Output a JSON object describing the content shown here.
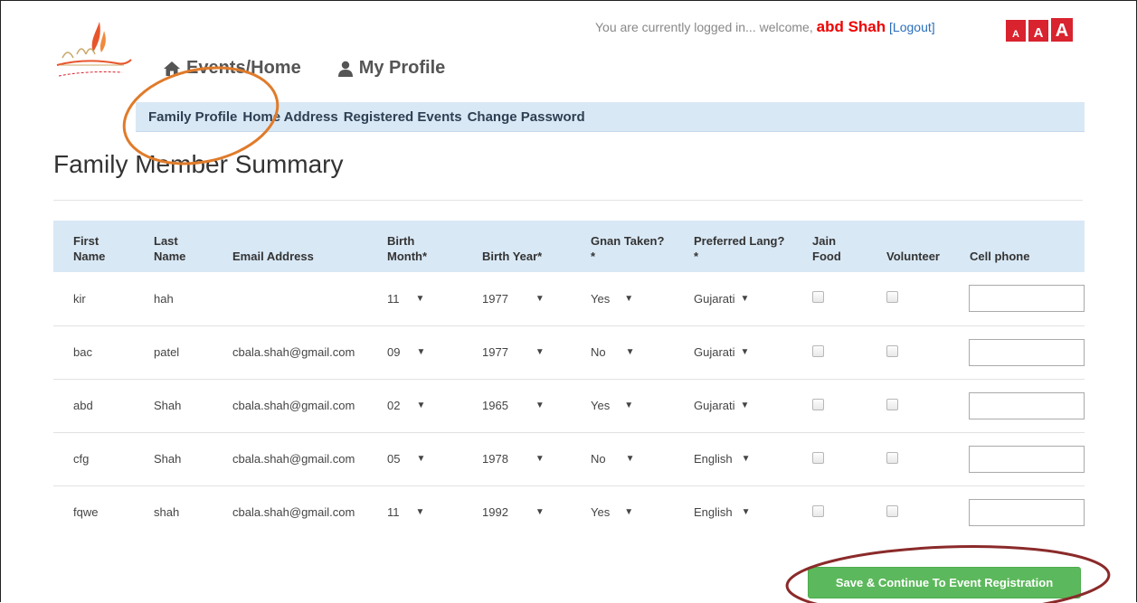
{
  "header": {
    "login_prefix": "You are currently logged in... welcome,",
    "user_name": "abd Shah",
    "logout_label": "[Logout]",
    "font_size_labels": [
      "A",
      "A",
      "A"
    ]
  },
  "top_nav": {
    "events_home": "Events/Home",
    "my_profile": "My Profile"
  },
  "sub_nav": [
    "Family Profile",
    "Home Address",
    "Registered Events",
    "Change Password"
  ],
  "page_title": "Family Member Summary",
  "table": {
    "headers": {
      "first_name": [
        "First",
        "Name"
      ],
      "last_name": [
        "Last",
        "Name"
      ],
      "email": "Email Address",
      "birth_month": [
        "Birth",
        "Month*"
      ],
      "birth_year": "Birth Year*",
      "gnan_taken": [
        "Gnan Taken?",
        "*"
      ],
      "preferred_lang": [
        "Preferred Lang?",
        "*"
      ],
      "jain_food": [
        "Jain",
        "Food"
      ],
      "volunteer": "Volunteer",
      "cell_phone": "Cell phone"
    },
    "rows": [
      {
        "first": "kir",
        "last": "hah",
        "email": "",
        "month": "11",
        "year": "1977",
        "gnan": "Yes",
        "lang": "Gujarati",
        "jain_food": false,
        "volunteer": false,
        "cell": ""
      },
      {
        "first": "bac",
        "last": "patel",
        "email": "cbala.shah@gmail.com",
        "month": "09",
        "year": "1977",
        "gnan": "No",
        "lang": "Gujarati",
        "jain_food": false,
        "volunteer": false,
        "cell": ""
      },
      {
        "first": "abd",
        "last": "Shah",
        "email": "cbala.shah@gmail.com",
        "month": "02",
        "year": "1965",
        "gnan": "Yes",
        "lang": "Gujarati",
        "jain_food": false,
        "volunteer": false,
        "cell": ""
      },
      {
        "first": "cfg",
        "last": "Shah",
        "email": "cbala.shah@gmail.com",
        "month": "05",
        "year": "1978",
        "gnan": "No",
        "lang": "English",
        "jain_food": false,
        "volunteer": false,
        "cell": ""
      },
      {
        "first": "fqwe",
        "last": "shah",
        "email": "cbala.shah@gmail.com",
        "month": "11",
        "year": "1992",
        "gnan": "Yes",
        "lang": "English",
        "jain_food": false,
        "volunteer": false,
        "cell": ""
      }
    ]
  },
  "save_button_label": "Save & Continue To Event Registration",
  "colors": {
    "subnav_bg": "#d9e8f5",
    "save_button": "#5cb85c",
    "font_size_buttons": "#d9232f",
    "user_name": "#e00000",
    "annotation_orange": "#e07b2a",
    "annotation_maroon": "#8b2a2a"
  },
  "icons": {
    "events_home": "home-icon",
    "my_profile": "user-icon",
    "select_arrow": "caret-down-icon"
  }
}
